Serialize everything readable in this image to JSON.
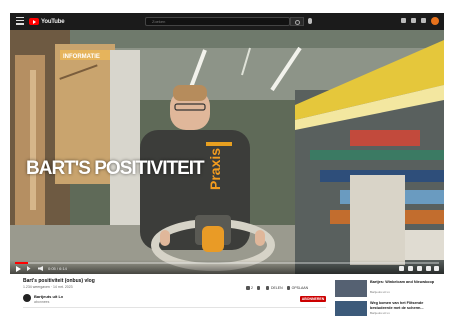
{
  "header": {
    "logo_text": "YouTube",
    "search_placeholder": "Zoeken",
    "accent_color": "#ff0000"
  },
  "player": {
    "overlay_text": "BART'S POSITIVITEIT",
    "sign_text": "INFORMATIE",
    "shirt_brand": "Praxis",
    "progress_fraction": 0.03,
    "time_display": "0:05 / 6:14"
  },
  "video": {
    "title": "Bart's positiviteit (onbus) vlog",
    "meta": "1.234 weergaven · 14 mrt. 2023",
    "channel_name": "Bartjeuts uit Lx",
    "channel_subs": "abonnees",
    "actions": [
      {
        "icon": "thumb-up-icon",
        "label": "2"
      },
      {
        "icon": "thumb-down-icon",
        "label": ""
      },
      {
        "icon": "share-icon",
        "label": "DELEN"
      },
      {
        "icon": "save-icon",
        "label": "OPSLAAN"
      }
    ],
    "subscribe_label": "ABONNEREN"
  },
  "sidebar": {
    "items": [
      {
        "title": "Bartjes: Winkelcam and Nieuwkoop",
        "channel": "Bartjeuts uit Lx"
      },
      {
        "title": "Weg komen van het Flitsende bestudeerde met de scherm...",
        "channel": "Bartjeuts uit Lx"
      }
    ]
  }
}
